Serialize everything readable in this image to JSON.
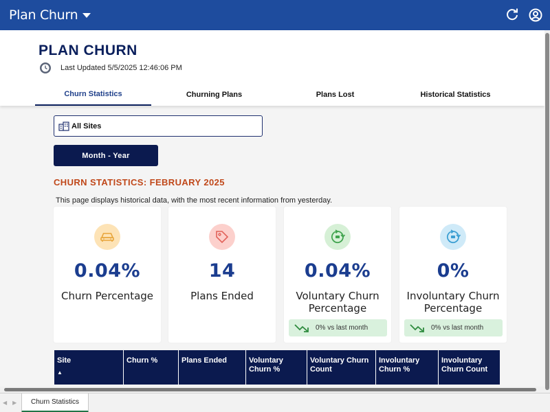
{
  "topbar": {
    "app_title": "Plan Churn",
    "icons": [
      "refresh-icon",
      "user-circle-icon"
    ],
    "color": "#1e4c9e"
  },
  "header": {
    "title": "PLAN CHURN",
    "last_updated": "Last Updated 5/5/2025 12:46:06 PM"
  },
  "tabs": [
    {
      "label": "Churn Statistics",
      "active": true
    },
    {
      "label": "Churning Plans",
      "active": false
    },
    {
      "label": "Plans Lost",
      "active": false
    },
    {
      "label": "Historical Statistics",
      "active": false
    }
  ],
  "filters": {
    "site_label": "All Sites",
    "period_button": "Month - Year"
  },
  "section": {
    "title": "CHURN STATISTICS: FEBRUARY 2025",
    "description": "This page displays historical data, with the most recent information from yesterday."
  },
  "cards": [
    {
      "icon": "car-icon",
      "value": "0.04%",
      "label": "Churn Percentage",
      "trend": null,
      "icon_bg": "#fde3b6"
    },
    {
      "icon": "tag-icon",
      "value": "14",
      "label": "Plans Ended",
      "trend": null,
      "icon_bg": "#fcd0cc"
    },
    {
      "icon": "recycle-icon",
      "value": "0.04%",
      "label": "Voluntary Churn Percentage",
      "trend": "0% vs last month",
      "icon_bg": "#d6f0d6"
    },
    {
      "icon": "recycle-icon",
      "value": "0%",
      "label": "Involuntary Churn Percentage",
      "trend": "0% vs last month",
      "icon_bg": "#cfeaf8"
    }
  ],
  "table": {
    "columns": [
      "Site",
      "Churn %",
      "Plans Ended",
      "Voluntary Churn %",
      "Voluntary Churn Count",
      "Involuntary Churn %",
      "Involuntary Churn Count"
    ],
    "sort_indicator": "▲"
  },
  "footer": {
    "sheet_tab": "Churn Statistics"
  },
  "colors": {
    "navy": "#0b1a4f",
    "accent_orange": "#c0481a",
    "value_blue": "#1b3d8f",
    "trend_green": "#d9f1dd"
  }
}
